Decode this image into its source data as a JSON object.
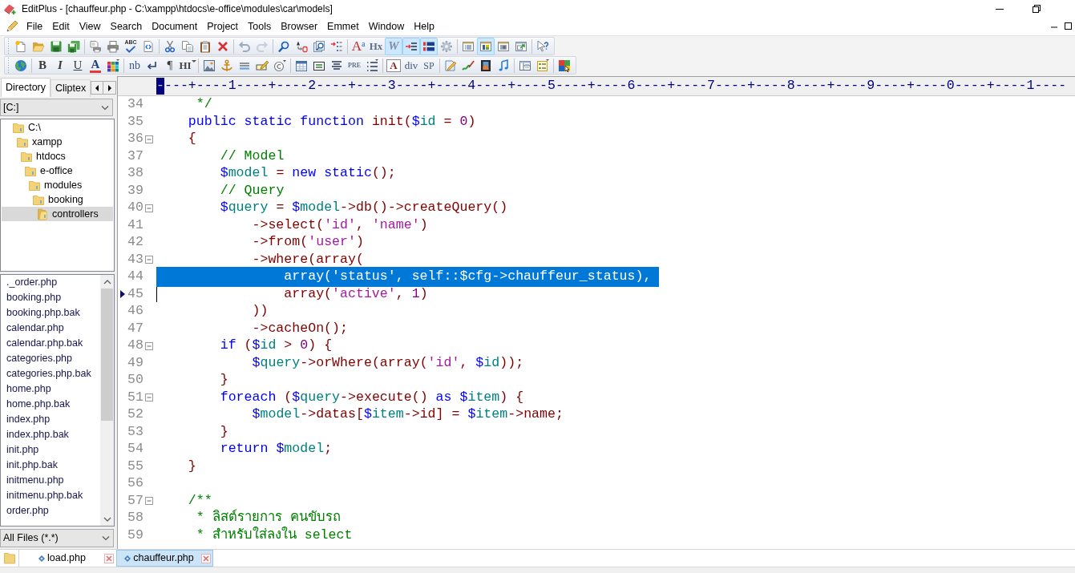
{
  "window": {
    "title": "EditPlus - [chauffeur.php - C:\\xampp\\htdocs\\e-office\\modules\\car\\models]"
  },
  "menu": [
    "File",
    "Edit",
    "View",
    "Search",
    "Document",
    "Project",
    "Tools",
    "Browser",
    "Emmet",
    "Window",
    "Help"
  ],
  "toolbars": [
    {
      "items": [
        {
          "kind": "button",
          "pressed": false
        },
        {
          "kind": "button",
          "pressed": false
        },
        {
          "kind": "button",
          "pressed": false
        },
        {
          "kind": "button",
          "pressed": false
        },
        {
          "kind": "separator"
        },
        {
          "kind": "button",
          "pressed": false
        },
        {
          "kind": "button",
          "pressed": false
        },
        {
          "kind": "button",
          "label": "ABC",
          "pressed": false
        },
        {
          "kind": "button",
          "pressed": false
        },
        {
          "kind": "separator"
        },
        {
          "kind": "button",
          "pressed": false
        },
        {
          "kind": "button",
          "pressed": false
        },
        {
          "kind": "button",
          "pressed": false
        },
        {
          "kind": "button",
          "pressed": false
        },
        {
          "kind": "separator"
        },
        {
          "kind": "button",
          "pressed": false
        },
        {
          "kind": "button",
          "pressed": false
        },
        {
          "kind": "separator"
        },
        {
          "kind": "button",
          "pressed": false
        },
        {
          "kind": "button",
          "pressed": false
        },
        {
          "kind": "button",
          "pressed": false
        },
        {
          "kind": "button",
          "pressed": false
        },
        {
          "kind": "separator"
        },
        {
          "kind": "button",
          "label": "A$^{a}$",
          "pressed": false
        },
        {
          "kind": "button",
          "label": "Hx",
          "pressed": false
        },
        {
          "kind": "button",
          "label": "W",
          "pressed": true
        },
        {
          "kind": "button",
          "pressed": true
        },
        {
          "kind": "button",
          "pressed": true
        },
        {
          "kind": "button",
          "pressed": false
        },
        {
          "kind": "separator"
        },
        {
          "kind": "button",
          "pressed": false
        },
        {
          "kind": "button",
          "pressed": true
        },
        {
          "kind": "button",
          "pressed": false
        },
        {
          "kind": "button",
          "pressed": false
        },
        {
          "kind": "separator"
        },
        {
          "kind": "button",
          "pressed": false
        }
      ]
    },
    {
      "items": [
        {
          "kind": "button",
          "pressed": false
        },
        {
          "kind": "separator"
        },
        {
          "kind": "button",
          "label": "B",
          "pressed": false
        },
        {
          "kind": "button",
          "label": "I",
          "pressed": false
        },
        {
          "kind": "button",
          "label": "U",
          "pressed": false
        },
        {
          "kind": "button",
          "label": "A",
          "pressed": false
        },
        {
          "kind": "button",
          "pressed": false
        },
        {
          "kind": "separator"
        },
        {
          "kind": "button",
          "label": "nb",
          "pressed": false
        },
        {
          "kind": "button",
          "pressed": false
        },
        {
          "kind": "button",
          "label": "¶",
          "pressed": false
        },
        {
          "kind": "button",
          "label": "HI",
          "pressed": false
        },
        {
          "kind": "separator"
        },
        {
          "kind": "button",
          "pressed": false
        },
        {
          "kind": "button",
          "pressed": false
        },
        {
          "kind": "button",
          "pressed": false
        },
        {
          "kind": "button",
          "pressed": false
        },
        {
          "kind": "button",
          "pressed": false
        },
        {
          "kind": "separator"
        },
        {
          "kind": "button",
          "pressed": false
        },
        {
          "kind": "button",
          "pressed": false
        },
        {
          "kind": "button",
          "pressed": false
        },
        {
          "kind": "button",
          "label": "PRE",
          "pressed": false
        },
        {
          "kind": "button",
          "pressed": false
        },
        {
          "kind": "separator"
        },
        {
          "kind": "button",
          "label": "A",
          "pressed": false
        },
        {
          "kind": "button",
          "label": "div",
          "pressed": false
        },
        {
          "kind": "button",
          "label": "SP",
          "pressed": false
        },
        {
          "kind": "separator"
        },
        {
          "kind": "button",
          "pressed": false
        },
        {
          "kind": "button",
          "pressed": false
        },
        {
          "kind": "button",
          "pressed": false
        },
        {
          "kind": "button",
          "pressed": false
        },
        {
          "kind": "separator"
        },
        {
          "kind": "button",
          "pressed": false
        },
        {
          "kind": "button",
          "pressed": false
        },
        {
          "kind": "separator"
        },
        {
          "kind": "button",
          "pressed": false
        }
      ]
    }
  ],
  "sidebar": {
    "tabs": [
      {
        "label": "Directory",
        "selected": true
      },
      {
        "label": "Cliptex",
        "selected": false
      }
    ],
    "drive": "[C:]",
    "tree": [
      {
        "label": "C:\\",
        "selected": false,
        "children": [
          {
            "label": "xampp",
            "selected": false,
            "children": [
              {
                "label": "htdocs",
                "selected": false,
                "children": [
                  {
                    "label": "e-office",
                    "selected": false,
                    "children": [
                      {
                        "label": "modules",
                        "selected": false,
                        "children": [
                          {
                            "label": "booking",
                            "selected": false,
                            "children": [
                              {
                                "label": "controllers",
                                "selected": true
                              }
                            ]
                          }
                        ]
                      }
                    ]
                  }
                ]
              }
            ]
          }
        ]
      }
    ],
    "files": [
      {
        "name": "._order.php",
        "selected": false
      },
      {
        "name": "booking.php",
        "selected": false
      },
      {
        "name": "booking.php.bak",
        "selected": false
      },
      {
        "name": "calendar.php",
        "selected": false
      },
      {
        "name": "calendar.php.bak",
        "selected": false
      },
      {
        "name": "categories.php",
        "selected": false
      },
      {
        "name": "categories.php.bak",
        "selected": false
      },
      {
        "name": "home.php",
        "selected": false
      },
      {
        "name": "home.php.bak",
        "selected": false
      },
      {
        "name": "index.php",
        "selected": false
      },
      {
        "name": "index.php.bak",
        "selected": false
      },
      {
        "name": "init.php",
        "selected": false
      },
      {
        "name": "init.php.bak",
        "selected": false
      },
      {
        "name": "initmenu.php",
        "selected": false
      },
      {
        "name": "initmenu.php.bak",
        "selected": false
      },
      {
        "name": "order.php",
        "selected": false
      }
    ],
    "filter": "All Files (*.*)"
  },
  "editor": {
    "ruler": {
      "marked": "-",
      "text": "---+----1----+----2----+----3----+----4----+----5----+----6----+----7----+----8----+----9----+----0----+----1----"
    },
    "lines": [
      {
        "number": "34",
        "foldable": false,
        "selected": false,
        "cursor": false,
        "tokens": [
          {
            "kind": "comment",
            "text": "     */"
          }
        ]
      },
      {
        "number": "35",
        "foldable": false,
        "selected": false,
        "cursor": false,
        "tokens": [
          {
            "kind": "keyword",
            "text": "    public static function"
          },
          {
            "kind": "code",
            "text": " init("
          },
          {
            "kind": "variable",
            "text": "$id"
          },
          {
            "kind": "code",
            "text": " = "
          },
          {
            "kind": "number",
            "text": "0"
          },
          {
            "kind": "code",
            "text": ")"
          }
        ]
      },
      {
        "number": "36",
        "foldable": true,
        "selected": false,
        "cursor": false,
        "tokens": [
          {
            "kind": "code",
            "text": "    {"
          }
        ]
      },
      {
        "number": "37",
        "foldable": false,
        "selected": false,
        "cursor": false,
        "tokens": [
          {
            "kind": "comment",
            "text": "        // Model"
          }
        ]
      },
      {
        "number": "38",
        "foldable": false,
        "selected": false,
        "cursor": false,
        "tokens": [
          {
            "kind": "variable",
            "text": "        $model"
          },
          {
            "kind": "code",
            "text": " = "
          },
          {
            "kind": "keyword",
            "text": "new static"
          },
          {
            "kind": "code",
            "text": "();"
          }
        ]
      },
      {
        "number": "39",
        "foldable": false,
        "selected": false,
        "cursor": false,
        "tokens": [
          {
            "kind": "comment",
            "text": "        // Query"
          }
        ]
      },
      {
        "number": "40",
        "foldable": true,
        "selected": false,
        "cursor": false,
        "tokens": [
          {
            "kind": "variable",
            "text": "        $query"
          },
          {
            "kind": "code",
            "text": " = "
          },
          {
            "kind": "variable",
            "text": "$model"
          },
          {
            "kind": "code",
            "text": "->db()->createQuery()"
          }
        ]
      },
      {
        "number": "41",
        "foldable": false,
        "selected": false,
        "cursor": false,
        "tokens": [
          {
            "kind": "code",
            "text": "            ->select("
          },
          {
            "kind": "string",
            "text": "'id'"
          },
          {
            "kind": "code",
            "text": ", "
          },
          {
            "kind": "string",
            "text": "'name'"
          },
          {
            "kind": "code",
            "text": ")"
          }
        ]
      },
      {
        "number": "42",
        "foldable": false,
        "selected": false,
        "cursor": false,
        "tokens": [
          {
            "kind": "code",
            "text": "            ->from("
          },
          {
            "kind": "string",
            "text": "'user'"
          },
          {
            "kind": "code",
            "text": ")"
          }
        ]
      },
      {
        "number": "43",
        "foldable": true,
        "selected": false,
        "cursor": false,
        "tokens": [
          {
            "kind": "code",
            "text": "            ->where(array("
          }
        ]
      },
      {
        "number": "44",
        "foldable": false,
        "selected": true,
        "cursor": false,
        "tokens": [
          {
            "kind": "code",
            "text": "                array("
          },
          {
            "kind": "string",
            "text": "'status'"
          },
          {
            "kind": "code",
            "text": ", self::"
          },
          {
            "kind": "variable",
            "text": "$cfg"
          },
          {
            "kind": "code",
            "text": "->chauffeur_status),"
          }
        ]
      },
      {
        "number": "45",
        "foldable": false,
        "selected": false,
        "cursor": true,
        "tokens": [
          {
            "kind": "code",
            "text": "                array("
          },
          {
            "kind": "string",
            "text": "'active'"
          },
          {
            "kind": "code",
            "text": ", "
          },
          {
            "kind": "number",
            "text": "1"
          },
          {
            "kind": "code",
            "text": ")"
          }
        ]
      },
      {
        "number": "46",
        "foldable": false,
        "selected": false,
        "cursor": false,
        "tokens": [
          {
            "kind": "code",
            "text": "            ))"
          }
        ]
      },
      {
        "number": "47",
        "foldable": false,
        "selected": false,
        "cursor": false,
        "tokens": [
          {
            "kind": "code",
            "text": "            ->cacheOn();"
          }
        ]
      },
      {
        "number": "48",
        "foldable": true,
        "selected": false,
        "cursor": false,
        "tokens": [
          {
            "kind": "keyword",
            "text": "        if"
          },
          {
            "kind": "code",
            "text": " ("
          },
          {
            "kind": "variable",
            "text": "$id"
          },
          {
            "kind": "code",
            "text": " > "
          },
          {
            "kind": "number",
            "text": "0"
          },
          {
            "kind": "code",
            "text": ") {"
          }
        ]
      },
      {
        "number": "49",
        "foldable": false,
        "selected": false,
        "cursor": false,
        "tokens": [
          {
            "kind": "variable",
            "text": "            $query"
          },
          {
            "kind": "code",
            "text": "->orWhere(array("
          },
          {
            "kind": "string",
            "text": "'id'"
          },
          {
            "kind": "code",
            "text": ", "
          },
          {
            "kind": "variable",
            "text": "$id"
          },
          {
            "kind": "code",
            "text": "));"
          }
        ]
      },
      {
        "number": "50",
        "foldable": false,
        "selected": false,
        "cursor": false,
        "tokens": [
          {
            "kind": "code",
            "text": "        }"
          }
        ]
      },
      {
        "number": "51",
        "foldable": true,
        "selected": false,
        "cursor": false,
        "tokens": [
          {
            "kind": "keyword",
            "text": "        foreach"
          },
          {
            "kind": "code",
            "text": " ("
          },
          {
            "kind": "variable",
            "text": "$query"
          },
          {
            "kind": "code",
            "text": "->execute() "
          },
          {
            "kind": "keyword",
            "text": "as "
          },
          {
            "kind": "variable",
            "text": "$item"
          },
          {
            "kind": "code",
            "text": ") {"
          }
        ]
      },
      {
        "number": "52",
        "foldable": false,
        "selected": false,
        "cursor": false,
        "tokens": [
          {
            "kind": "variable",
            "text": "            $model"
          },
          {
            "kind": "code",
            "text": "->datas["
          },
          {
            "kind": "variable",
            "text": "$item"
          },
          {
            "kind": "code",
            "text": "->id] = "
          },
          {
            "kind": "variable",
            "text": "$item"
          },
          {
            "kind": "code",
            "text": "->name;"
          }
        ]
      },
      {
        "number": "53",
        "foldable": false,
        "selected": false,
        "cursor": false,
        "tokens": [
          {
            "kind": "code",
            "text": "        }"
          }
        ]
      },
      {
        "number": "54",
        "foldable": false,
        "selected": false,
        "cursor": false,
        "tokens": [
          {
            "kind": "keyword",
            "text": "        return "
          },
          {
            "kind": "variable",
            "text": "$model"
          },
          {
            "kind": "code",
            "text": ";"
          }
        ]
      },
      {
        "number": "55",
        "foldable": false,
        "selected": false,
        "cursor": false,
        "tokens": [
          {
            "kind": "code",
            "text": "    }"
          }
        ]
      },
      {
        "number": "56",
        "foldable": false,
        "selected": false,
        "cursor": false
      },
      {
        "number": "57",
        "foldable": true,
        "selected": false,
        "cursor": false,
        "tokens": [
          {
            "kind": "comment",
            "text": "    /**"
          }
        ]
      },
      {
        "number": "58",
        "foldable": false,
        "selected": false,
        "cursor": false,
        "tokens": [
          {
            "kind": "comment",
            "text": "     * ลิสต์รายการ คนขับรถ"
          }
        ]
      },
      {
        "number": "59",
        "foldable": false,
        "selected": false,
        "cursor": false,
        "tokens": [
          {
            "kind": "comment",
            "text": "     * สำหรับใส่ลงใน select"
          }
        ]
      }
    ]
  },
  "document_tabs": [
    {
      "label": "load.php",
      "selected": false
    },
    {
      "label": "chauffeur.php",
      "selected": true
    }
  ]
}
